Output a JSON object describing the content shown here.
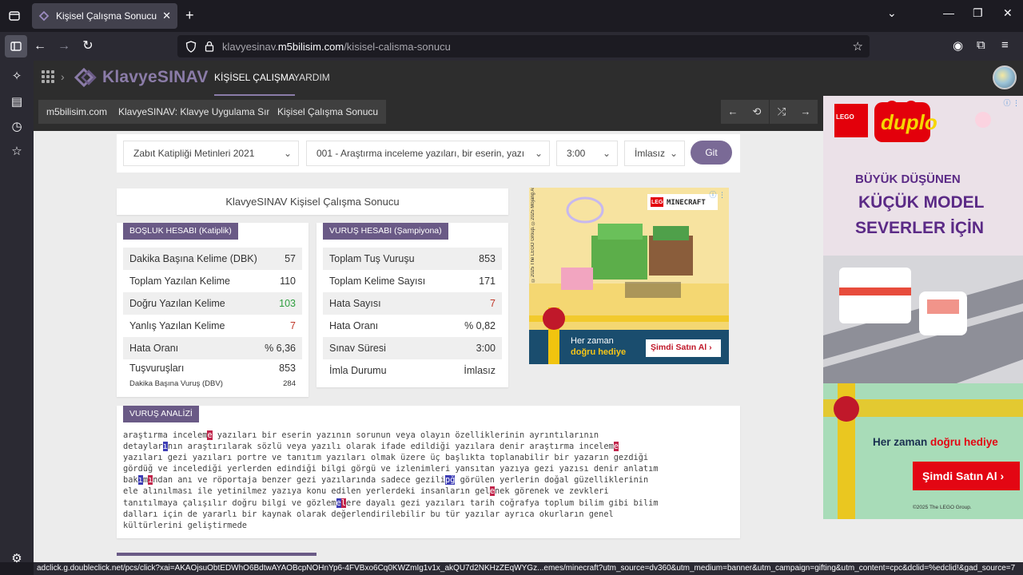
{
  "browser": {
    "tab_title": "Kişisel Çalışma Sonucu | KlavyeSINAV",
    "url_host_prefix": "klavyesinav.",
    "url_host_domain": "m5bilisim.com",
    "url_path": "/kisisel-calisma-sonucu",
    "status_url": "adclick.g.doubleclick.net/pcs/click?xai=AKAOjsuObtEDWhO6BdtwAYAOBcpNOHnYp6-4FVBxo6Cq0KWZmIg1v1x_akQU7d2NKHzZEqWYGz...emes/minecraft?utm_source=dv360&utm_medium=banner&utm_campaign=gifting&utm_content=cpc&dclid=%edclid!&gad_source=7"
  },
  "header": {
    "logo": "KlavyeSINAV",
    "nav": [
      "KİŞİSEL ÇALIŞMA",
      "YARDIM"
    ]
  },
  "breadcrumb": [
    "m5bilisim.com",
    "KlavyeSINAV: Klavye Uygulama Sınavı",
    "Kişisel Çalışma Sonucu"
  ],
  "controls": {
    "text_set": "Zabıt Katipliği Metinleri 2021",
    "text_item": "001 - Araştırma inceleme yazıları, bir eserin, yazı",
    "duration": "3:00",
    "spelling": "İmlasız",
    "go": "Git"
  },
  "result_title": "KlavyeSINAV Kişisel Çalışma Sonucu",
  "bosluk": {
    "header": "BOŞLUK HESABI (Katiplik)",
    "rows": [
      {
        "label": "Dakika Başına Kelime (DBK)",
        "value": "57"
      },
      {
        "label": "Toplam Yazılan Kelime",
        "value": "110"
      },
      {
        "label": "Doğru Yazılan Kelime",
        "value": "103"
      },
      {
        "label": "Yanlış Yazılan Kelime",
        "value": "7"
      },
      {
        "label": "Hata Oranı",
        "value": "% 6,36"
      },
      {
        "label": "Tuşvuruşları",
        "value": "853"
      }
    ],
    "sub_label": "Dakika Başına Vuruş (DBV)",
    "sub_value": "284"
  },
  "vurus": {
    "header": "VURUŞ HESABI (Şampiyona)",
    "rows": [
      {
        "label": "Toplam Tuş Vuruşu",
        "value": "853"
      },
      {
        "label": "Toplam Kelime Sayısı",
        "value": "171"
      },
      {
        "label": "Hata Sayısı",
        "value": "7"
      },
      {
        "label": "Hata Oranı",
        "value": "% 0,82"
      },
      {
        "label": "Sınav Süresi",
        "value": "3:00"
      },
      {
        "label": "İmla Durumu",
        "value": "İmlasız"
      }
    ]
  },
  "ad_mid": {
    "brand": "LEGO",
    "product": "MINECRAFT",
    "tagline_1": "Her zaman",
    "tagline_2": "doğru hediye",
    "cta": "Şimdi Satın Al ›",
    "legal": "©2025 The LEGO Group. ©2025 Mojang AB. TM Microsoft Corp."
  },
  "ad_right": {
    "brand": "LEGO",
    "product": "duplo",
    "headline_1": "BÜYÜK DÜŞÜNEN",
    "headline_2": "KÜÇÜK MODEL",
    "headline_3": "SEVERLER İÇİN",
    "tagline_1": "Her zaman ",
    "tagline_2": "doğru hediye",
    "cta": "Şimdi Satın Al ›",
    "legal": "©2025 The LEGO Group."
  },
  "analysis": {
    "header": "VURUŞ ANALİZİ"
  },
  "colors": {
    "accent": "#6a5a86",
    "logo": "#8b7ca8",
    "error_mark": "#c0244a",
    "warn_mark": "#3d3db5",
    "correct": "#2e9e3e"
  }
}
